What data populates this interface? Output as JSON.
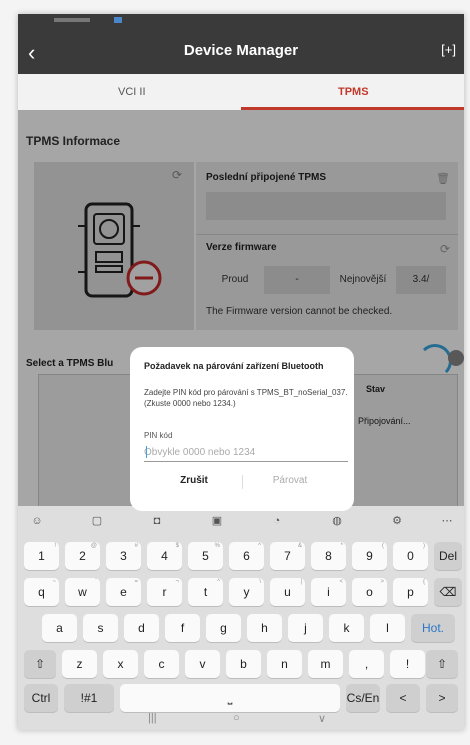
{
  "app": {
    "title": "Device Manager",
    "back_icon": "back-chevron-icon",
    "action_icon": "scan-icon"
  },
  "tabs": [
    {
      "label": "VCI II"
    },
    {
      "label": "TPMS",
      "active": true
    }
  ],
  "tpms_info": {
    "section_title": "TPMS Informace",
    "last_connected_label": "Poslední připojené TPMS",
    "firmware_label": "Verze firmware",
    "current_label": "Proud",
    "current_value": "-",
    "latest_label": "Nejnovější",
    "latest_value": "3.4/",
    "note": "The Firmware version cannot be checked."
  },
  "select": {
    "title": "Select a TPMS Blu",
    "status_header": "Stav",
    "status_value": "Připojování..."
  },
  "dialog": {
    "title": "Požadavek na párování zařízení Bluetooth",
    "message": "Zadejte PIN kód pro párování s TPMS_BT_noSerial_037. (Zkuste 0000 nebo 1234.)",
    "pin_label": "PIN kód",
    "pin_placeholder": "Obvykle 0000 nebo 1234",
    "cancel": "Zrušit",
    "pair": "Párovat"
  },
  "keyboard": {
    "row1": [
      [
        "1",
        "!"
      ],
      [
        "2",
        "@"
      ],
      [
        "3",
        "#"
      ],
      [
        "4",
        "$"
      ],
      [
        "5",
        "%"
      ],
      [
        "6",
        "^"
      ],
      [
        "7",
        "&"
      ],
      [
        "8",
        "*"
      ],
      [
        "9",
        "("
      ],
      [
        "0",
        ")"
      ]
    ],
    "row2": [
      [
        "q",
        "~"
      ],
      [
        "w",
        "`"
      ],
      [
        "e",
        "="
      ],
      [
        "r",
        "¬"
      ],
      [
        "t",
        "^"
      ],
      [
        "y",
        "\\"
      ],
      [
        "u",
        "|"
      ],
      [
        "i",
        "<"
      ],
      [
        "o",
        ">"
      ],
      [
        "p",
        "{"
      ]
    ],
    "row3": [
      [
        "a",
        " "
      ],
      [
        "s",
        ""
      ],
      [
        "d",
        ""
      ],
      [
        "f",
        ""
      ],
      [
        "g",
        ""
      ],
      [
        "h",
        ""
      ],
      [
        "j",
        ""
      ],
      [
        "k",
        ""
      ],
      [
        "l",
        ""
      ]
    ],
    "row4": [
      [
        "z",
        ""
      ],
      [
        "x",
        ""
      ],
      [
        "c",
        ""
      ],
      [
        "v",
        ""
      ],
      [
        "b",
        ""
      ],
      [
        "n",
        ""
      ],
      [
        "m",
        ""
      ]
    ],
    "punct": [
      ",",
      "!",
      "."
    ],
    "del": "Del",
    "hot": "Hot.",
    "ctrl": "Ctrl",
    "sym": "!#1",
    "lang": "Cs/En",
    "left": "<",
    "right": ">"
  }
}
